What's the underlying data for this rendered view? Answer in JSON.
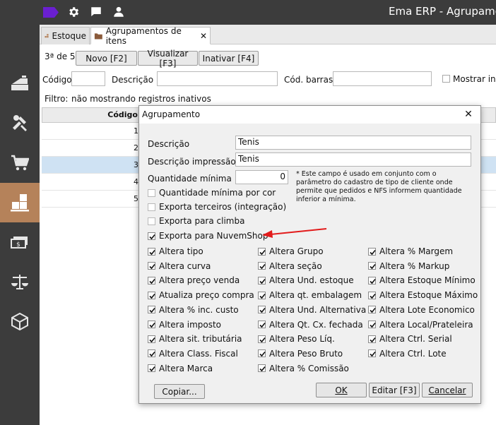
{
  "app": {
    "title": "Ema ERP - Agrupamento"
  },
  "tabs": [
    {
      "label": "Estoque"
    },
    {
      "label": "Agrupamentos de itens",
      "close": "✕"
    }
  ],
  "toolbar": {
    "record_counter": "3ª de 5",
    "new_label": "Novo [F2]",
    "view_label": "Visualizar [F3]",
    "deactivate_label": "Inativar [F4]",
    "code_label": "Código",
    "description_label": "Descrição",
    "barcode_label": "Cód. barras",
    "show_inactive_label": "Mostrar ina",
    "filter_label": "Filtro:",
    "filter_value": "não mostrando registros inativos"
  },
  "grid": {
    "header": "Código",
    "rows": [
      "1",
      "2",
      "3",
      "4",
      "5"
    ]
  },
  "dialog": {
    "title": "Agrupamento",
    "close": "✕",
    "desc_label": "Descrição",
    "desc_value": "Tenis",
    "desc_print_label": "Descrição impressão",
    "desc_print_value": "Tenis",
    "min_qty_label": "Quantidade mínima",
    "min_qty_value": "0",
    "note": "* Este campo é usado em conjunto com o parâmetro do cadastro de tipo de cliente onde permite que pedidos e NFS informem quantidade inferior a mínima.",
    "min_qty_color": "Quantidade mínima por cor",
    "export_third": "Exporta terceiros (integração)",
    "export_climba": "Exporta para climba",
    "export_nuvem": "Exporta para NuvemShop",
    "col1": [
      "Altera tipo",
      "Altera curva",
      "Altera preço venda",
      "Atualiza preço compra",
      "Altera % inc. custo",
      "Altera imposto",
      "Altera sit. tributária",
      "Altera Class. Fiscal",
      "Altera Marca"
    ],
    "col2": [
      "Altera Grupo",
      "Altera seção",
      "Altera Und. estoque",
      "Altera qt. embalagem",
      "Altera Und. Alternativa",
      "Altera Qt. Cx. fechada",
      "Altera Peso Líq.",
      "Altera Peso Bruto",
      "Altera % Comissão"
    ],
    "col3": [
      "Altera % Margem",
      "Altera % Markup",
      "Altera Estoque Mínimo",
      "Altera Estoque Máximo",
      "Altera Lote Economico",
      "Altera Local/Prateleira",
      "Altera Ctrl. Serial",
      "Altera Ctrl. Lote"
    ],
    "copy_button": "Copiar...",
    "ok_button": "OK",
    "edit_button": "Editar [F3]",
    "cancel_button": "Cancelar"
  },
  "colors": {
    "sidebar_bg": "#3c3c3c",
    "sidebar_active": "#b5825a",
    "logo_purple": "#6a1fd0",
    "arrow_red": "#e21b1b",
    "selected_row": "#cfe2f3"
  }
}
